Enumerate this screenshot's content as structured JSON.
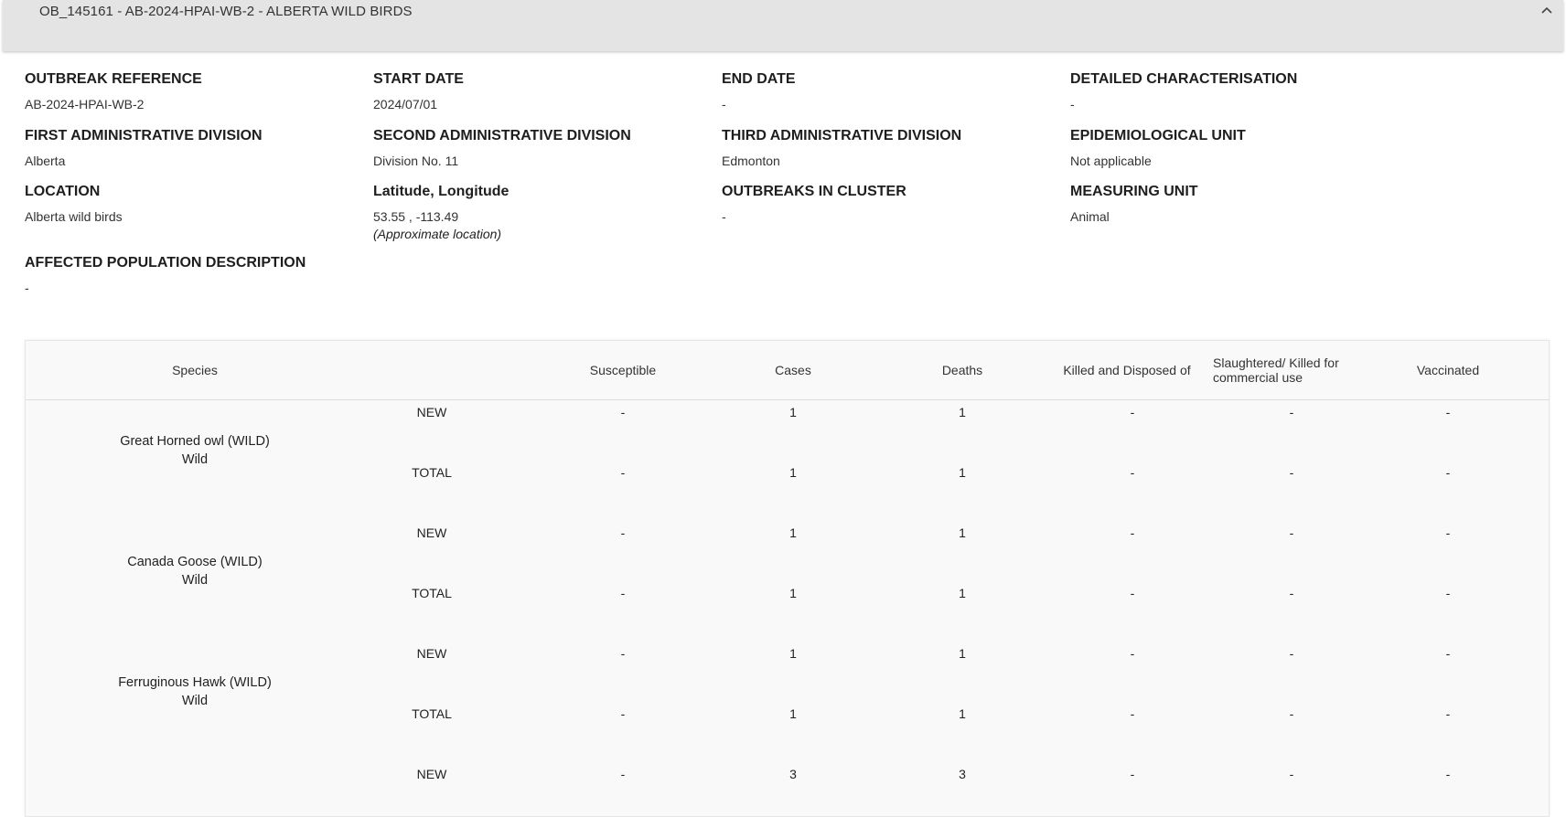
{
  "header": {
    "title": "OB_145161 - AB-2024-HPAI-WB-2 - ALBERTA WILD BIRDS",
    "collapse_icon": "chevron-up-icon"
  },
  "details": {
    "outbreak_reference": {
      "label": "OUTBREAK REFERENCE",
      "value": "AB-2024-HPAI-WB-2"
    },
    "start_date": {
      "label": "START DATE",
      "value": "2024/07/01"
    },
    "end_date": {
      "label": "END DATE",
      "value": "-"
    },
    "detailed_characterisation": {
      "label": "DETAILED CHARACTERISATION",
      "value": "-"
    },
    "first_admin_division": {
      "label": "FIRST ADMINISTRATIVE DIVISION",
      "value": "Alberta"
    },
    "second_admin_division": {
      "label": "SECOND ADMINISTRATIVE DIVISION",
      "value": "Division No. 11"
    },
    "third_admin_division": {
      "label": "THIRD ADMINISTRATIVE DIVISION",
      "value": "Edmonton"
    },
    "epidemiological_unit": {
      "label": "EPIDEMIOLOGICAL UNIT",
      "value": "Not applicable"
    },
    "location": {
      "label": "LOCATION",
      "value": "Alberta wild birds"
    },
    "lat_long": {
      "label": "Latitude, Longitude",
      "value": "53.55 , -113.49",
      "note": "(Approximate location)"
    },
    "outbreaks_in_cluster": {
      "label": "OUTBREAKS IN CLUSTER",
      "value": "-"
    },
    "measuring_unit": {
      "label": "MEASURING UNIT",
      "value": "Animal"
    },
    "affected_population": {
      "label": "AFFECTED POPULATION DESCRIPTION",
      "value": "-"
    }
  },
  "table": {
    "headers": {
      "species": "Species",
      "susceptible": "Susceptible",
      "cases": "Cases",
      "deaths": "Deaths",
      "killed": "Killed and Disposed of",
      "slaughtered": "Slaughtered/ Killed for commercial use",
      "vaccinated": "Vaccinated"
    },
    "rows": [
      {
        "species": "Great Horned owl (WILD)",
        "kind": "Wild",
        "new": {
          "label": "NEW",
          "susceptible": "-",
          "cases": "1",
          "deaths": "1",
          "killed": "-",
          "slaughtered": "-",
          "vaccinated": "-"
        },
        "total": {
          "label": "TOTAL",
          "susceptible": "-",
          "cases": "1",
          "deaths": "1",
          "killed": "-",
          "slaughtered": "-",
          "vaccinated": "-"
        }
      },
      {
        "species": "Canada Goose (WILD)",
        "kind": "Wild",
        "new": {
          "label": "NEW",
          "susceptible": "-",
          "cases": "1",
          "deaths": "1",
          "killed": "-",
          "slaughtered": "-",
          "vaccinated": "-"
        },
        "total": {
          "label": "TOTAL",
          "susceptible": "-",
          "cases": "1",
          "deaths": "1",
          "killed": "-",
          "slaughtered": "-",
          "vaccinated": "-"
        }
      },
      {
        "species": "Ferruginous Hawk (WILD)",
        "kind": "Wild",
        "new": {
          "label": "NEW",
          "susceptible": "-",
          "cases": "1",
          "deaths": "1",
          "killed": "-",
          "slaughtered": "-",
          "vaccinated": "-"
        },
        "total": {
          "label": "TOTAL",
          "susceptible": "-",
          "cases": "1",
          "deaths": "1",
          "killed": "-",
          "slaughtered": "-",
          "vaccinated": "-"
        }
      },
      {
        "species": "",
        "kind": "",
        "new": {
          "label": "NEW",
          "susceptible": "-",
          "cases": "3",
          "deaths": "3",
          "killed": "-",
          "slaughtered": "-",
          "vaccinated": "-"
        }
      }
    ]
  }
}
